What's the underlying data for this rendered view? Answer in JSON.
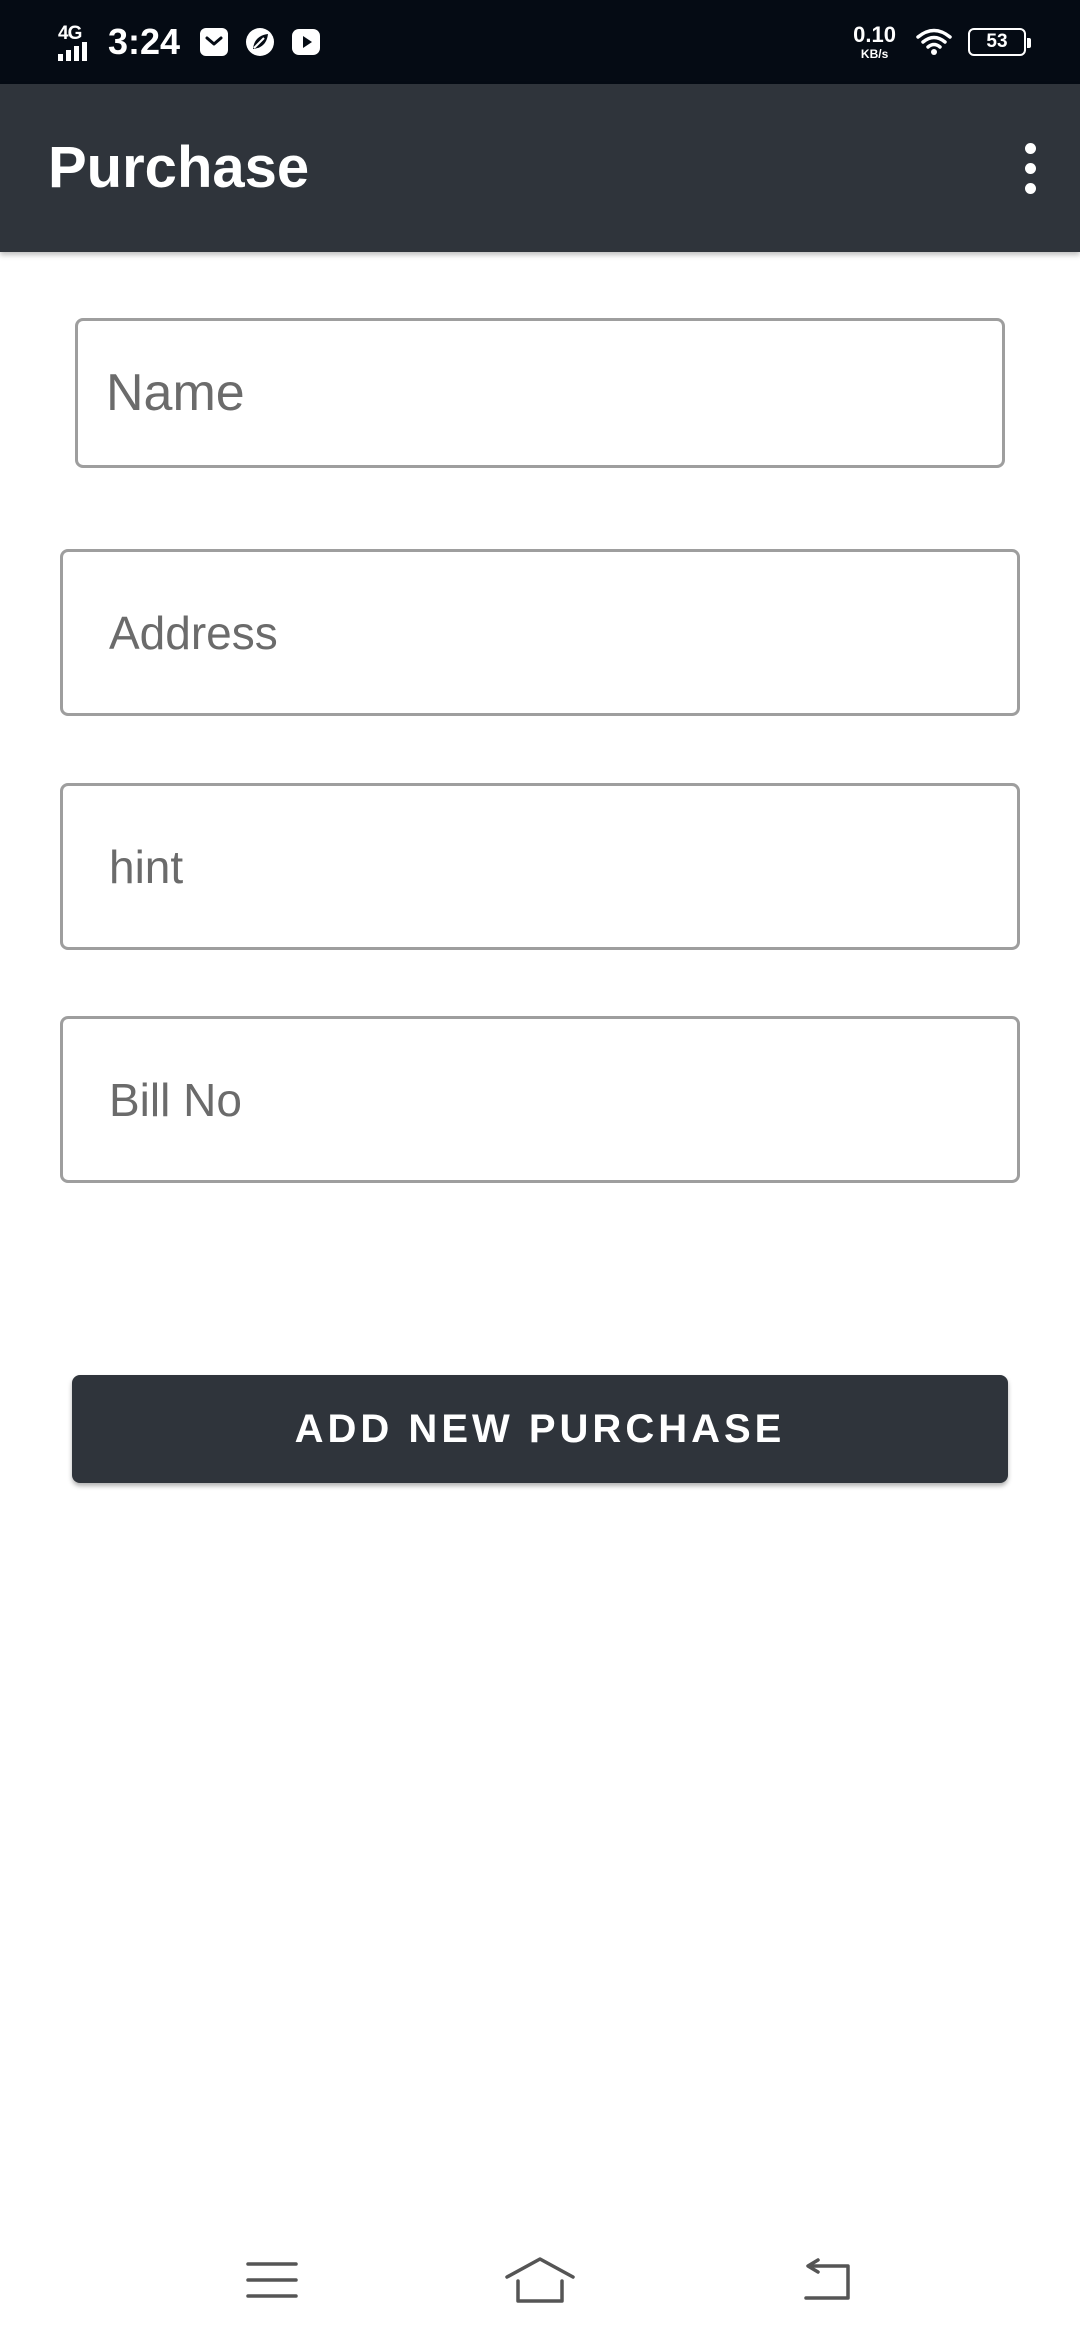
{
  "status_bar": {
    "network": "4G",
    "time": "3:24",
    "speed_value": "0.10",
    "speed_unit": "KB/s",
    "battery": "53"
  },
  "app_bar": {
    "title": "Purchase",
    "menu_icon": "more-vert-icon"
  },
  "form": {
    "name_placeholder": "Name",
    "address_placeholder": "Address",
    "hint_placeholder": "hint",
    "billno_placeholder": "Bill No",
    "submit_label": "ADD NEW PURCHASE"
  },
  "nav": {
    "icons": [
      "menu-icon",
      "home-icon",
      "back-icon"
    ]
  },
  "colors": {
    "status_bar": "#050b14",
    "app_bar": "#2f343b",
    "button": "#2f343b",
    "field_border": "#9e9e9e",
    "placeholder": "#6b6b6b"
  }
}
